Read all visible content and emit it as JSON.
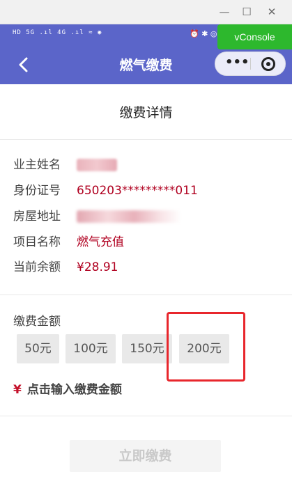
{
  "window": {
    "minimize": "—",
    "maximize": "☐",
    "close": "✕"
  },
  "status_bar": {
    "left": "HD 5G .ıl  4G .ıl  ≈  ◉",
    "right": "⏰ ✱ ◎"
  },
  "vconsole": {
    "label": "vConsole"
  },
  "nav": {
    "title": "燃气缴费",
    "back_icon": "chevron-left",
    "more_icon": "dots",
    "close_icon": "target"
  },
  "page": {
    "title": "缴费详情"
  },
  "details": [
    {
      "label": "业主姓名",
      "value": ""
    },
    {
      "label": "身份证号",
      "value": "650203*********011"
    },
    {
      "label": "房屋地址",
      "value": ""
    },
    {
      "label": "项目名称",
      "value": "燃气充值"
    },
    {
      "label": "当前余额",
      "value": "¥28.91"
    }
  ],
  "payment": {
    "label": "缴费金额",
    "options": [
      "50元",
      "100元",
      "150元",
      "200元"
    ],
    "custom_symbol": "¥",
    "custom_label": "点击输入缴费金额"
  },
  "submit": {
    "label": "立即缴费"
  },
  "colors": {
    "nav_bg": "#5b65c9",
    "value_red": "#b00020",
    "highlight": "#e8262c",
    "vconsole": "#2db82d"
  }
}
